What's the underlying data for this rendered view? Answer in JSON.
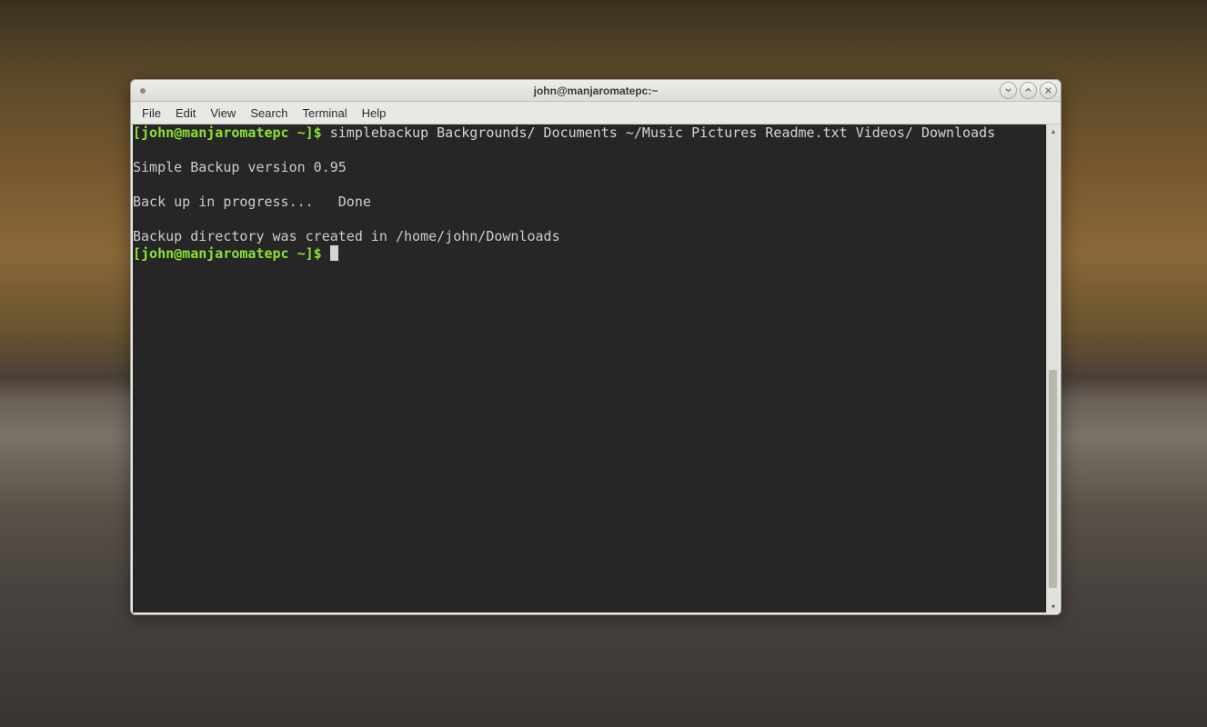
{
  "window": {
    "title": "john@manjaromatepc:~"
  },
  "menu": {
    "file": "File",
    "edit": "Edit",
    "view": "View",
    "search": "Search",
    "terminal": "Terminal",
    "help": "Help"
  },
  "terminal": {
    "prompt1_user": "[john@manjaromatepc",
    "prompt1_path": " ~",
    "prompt1_end": "]$ ",
    "command": "simplebackup Backgrounds/ Documents ~/Music Pictures Readme.txt Videos/ Downloads",
    "blank1": "",
    "out1": "Simple Backup version 0.95",
    "blank2": "",
    "out2": "Back up in progress...   Done",
    "blank3": "",
    "out3": "Backup directory was created in /home/john/Downloads",
    "prompt2_user": "[john@manjaromatepc",
    "prompt2_path": " ~",
    "prompt2_end": "]$ "
  },
  "icons": {
    "minimize": "minimize-icon",
    "maximize": "maximize-icon",
    "close": "close-icon"
  }
}
